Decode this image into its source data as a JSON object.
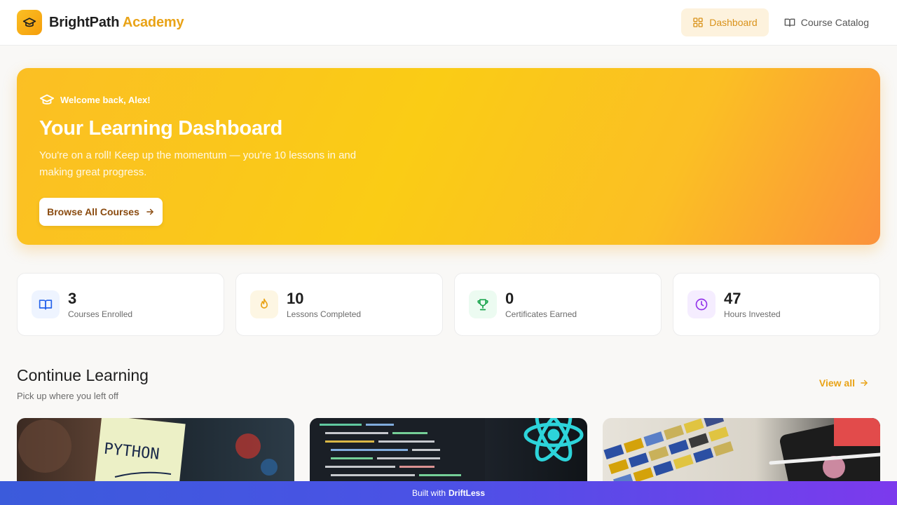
{
  "header": {
    "brand_primary": "BrightPath",
    "brand_accent": "Academy",
    "nav": [
      {
        "label": "Dashboard",
        "icon": "grid-icon",
        "active": true
      },
      {
        "label": "Course Catalog",
        "icon": "book-icon",
        "active": false
      }
    ]
  },
  "hero": {
    "kicker": "Welcome back, Alex!",
    "title": "Your Learning Dashboard",
    "description": "You're on a roll! Keep up the momentum — you're 10 lessons in and making great progress.",
    "button_label": "Browse All Courses"
  },
  "stats": [
    {
      "value": "3",
      "label": "Courses Enrolled",
      "icon": "book-open-icon",
      "color": "#2563eb",
      "bg": "#eef4ff"
    },
    {
      "value": "10",
      "label": "Lessons Completed",
      "icon": "flame-icon",
      "color": "#e9a317",
      "bg": "#fdf6e3"
    },
    {
      "value": "0",
      "label": "Certificates Earned",
      "icon": "trophy-icon",
      "color": "#16a34a",
      "bg": "#ecfbf1"
    },
    {
      "value": "47",
      "label": "Hours Invested",
      "icon": "clock-icon",
      "color": "#9333ea",
      "bg": "#f5edff"
    }
  ],
  "continue": {
    "title": "Continue Learning",
    "subtitle": "Pick up where you left off",
    "view_all": "View all",
    "card_texts": [
      "PYTHON"
    ]
  },
  "footer": {
    "prefix": "Built with",
    "brand": "DriftLess"
  },
  "colors": {
    "accent": "#e9a317",
    "hero_start": "#fbbf24",
    "hero_end": "#fb923c"
  }
}
